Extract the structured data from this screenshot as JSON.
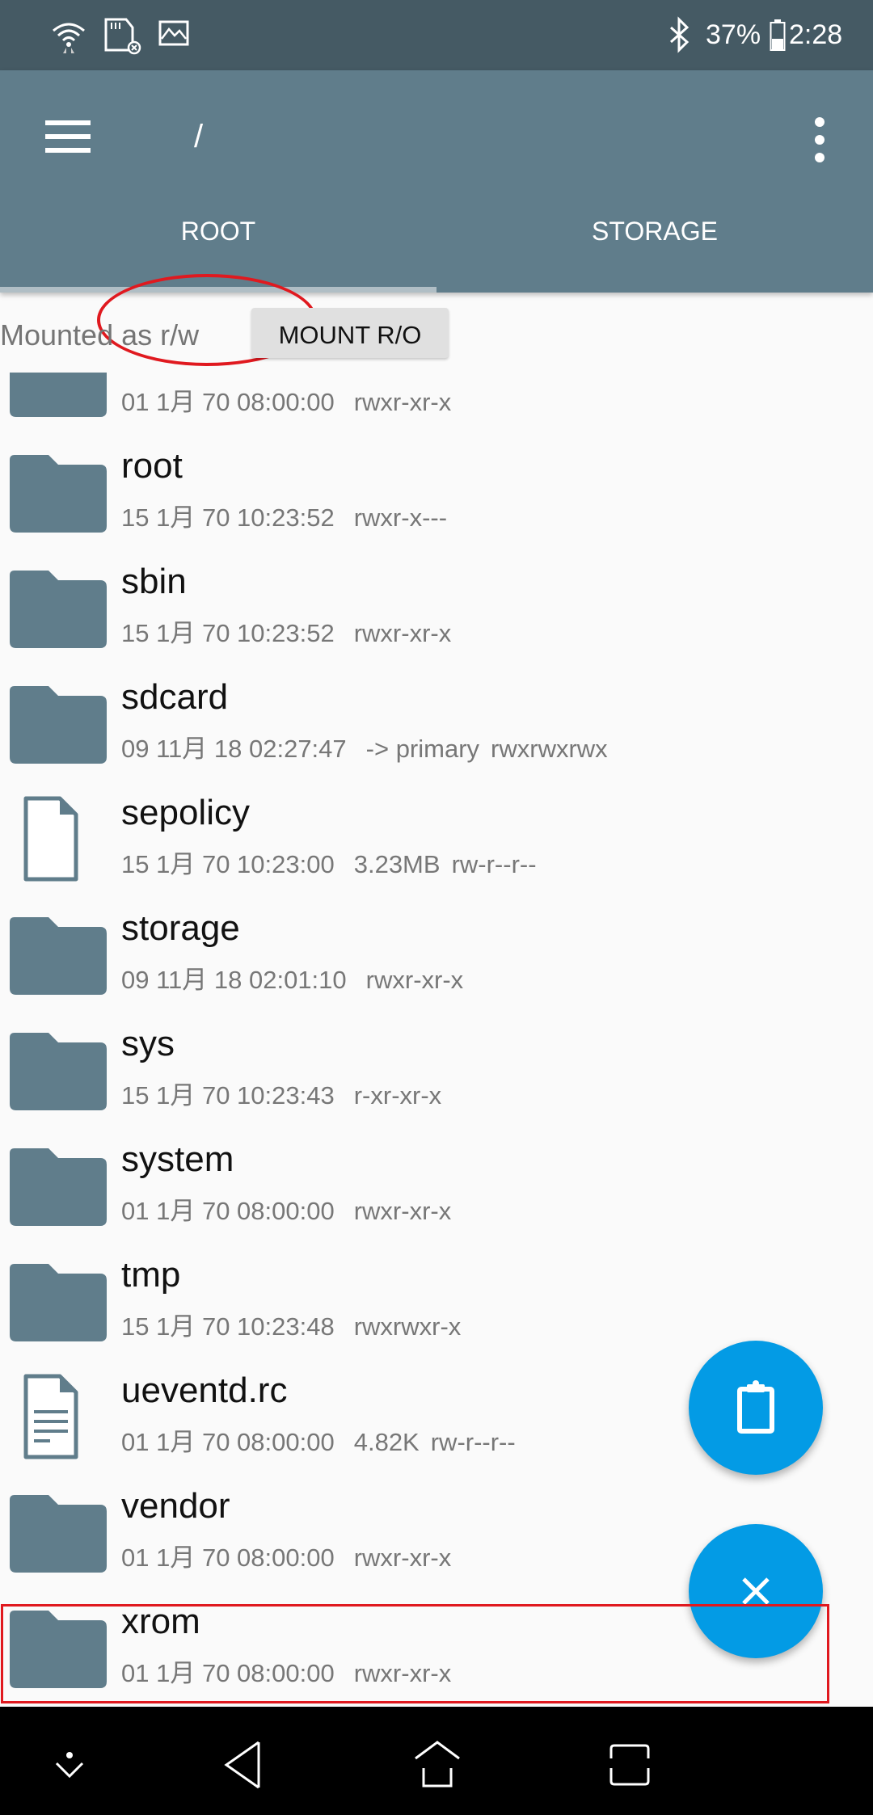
{
  "status_bar": {
    "left_icons": [
      "wifi-icon",
      "sd-card-icon",
      "image-icon"
    ],
    "right_icons": [
      "bluetooth-icon",
      "battery-icon"
    ],
    "battery": "37%",
    "time": "2:28"
  },
  "toolbar": {
    "title": "/",
    "menu_icon": "hamburger-icon",
    "overflow_icon": "more-vert-icon"
  },
  "tabs": [
    {
      "label": "ROOT",
      "selected": true
    },
    {
      "label": "STORAGE",
      "selected": false
    }
  ],
  "mount": {
    "status": "Mounted as r/w",
    "button": "MOUNT R/O"
  },
  "files": [
    {
      "name": "",
      "date": "01 1月 70 08:00:00",
      "extra": "",
      "perms": "rwxr-xr-x",
      "type": "folder"
    },
    {
      "name": "root",
      "date": "15 1月 70 10:23:52",
      "extra": "",
      "perms": "rwxr-x---",
      "type": "folder"
    },
    {
      "name": "sbin",
      "date": "15 1月 70 10:23:52",
      "extra": "",
      "perms": "rwxr-xr-x",
      "type": "folder"
    },
    {
      "name": "sdcard",
      "date": "09 11月 18 02:27:47",
      "extra": "-> primary",
      "perms": "rwxrwxrwx",
      "type": "folder"
    },
    {
      "name": "sepolicy",
      "date": "15 1月 70 10:23:00",
      "extra": "3.23MB",
      "perms": "rw-r--r--",
      "type": "file"
    },
    {
      "name": "storage",
      "date": "09 11月 18 02:01:10",
      "extra": "",
      "perms": "rwxr-xr-x",
      "type": "folder"
    },
    {
      "name": "sys",
      "date": "15 1月 70 10:23:43",
      "extra": "",
      "perms": "r-xr-xr-x",
      "type": "folder"
    },
    {
      "name": "system",
      "date": "01 1月 70 08:00:00",
      "extra": "",
      "perms": "rwxr-xr-x",
      "type": "folder"
    },
    {
      "name": "tmp",
      "date": "15 1月 70 10:23:48",
      "extra": "",
      "perms": "rwxrwxr-x",
      "type": "folder"
    },
    {
      "name": "ueventd.rc",
      "date": "01 1月 70 08:00:00",
      "extra": "4.82K",
      "perms": "rw-r--r--",
      "type": "text-file"
    },
    {
      "name": "vendor",
      "date": "01 1月 70 08:00:00",
      "extra": "",
      "perms": "rwxr-xr-x",
      "type": "folder"
    },
    {
      "name": "xrom",
      "date": "01 1月 70 08:00:00",
      "extra": "",
      "perms": "rwxr-xr-x",
      "type": "folder"
    }
  ],
  "fabs": [
    {
      "icon": "clipboard-icon",
      "action": "paste"
    },
    {
      "icon": "close-icon",
      "action": "cancel"
    }
  ],
  "colors": {
    "status_bar": "#455a64",
    "toolbar": "#607d8b",
    "folder": "#607d8b",
    "fab": "#039be5",
    "annotation": "#e0191f"
  }
}
